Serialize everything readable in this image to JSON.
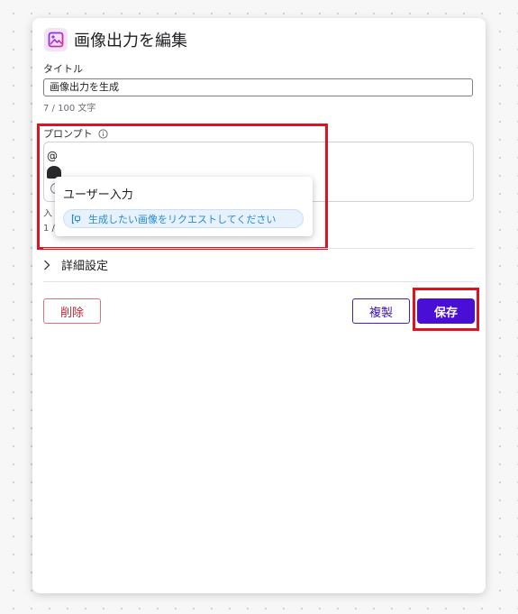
{
  "dialog": {
    "title": "画像出力を編集",
    "icon": "image-icon"
  },
  "title_field": {
    "label": "タイトル",
    "value": "画像出力を生成",
    "counter": "7 / 100 文字"
  },
  "prompt_field": {
    "label": "プロンプト",
    "info_icon": "info-icon",
    "text": "@",
    "peek_label_fragment": "入",
    "peek_counter_fragment": "1 /"
  },
  "mention_dropdown": {
    "title": "ユーザー入力",
    "option_icon": "variable-icon",
    "option_label": "生成したい画像をリクエストしてください"
  },
  "details": {
    "label": "詳細設定",
    "icon": "chevron-right-icon"
  },
  "actions": {
    "delete_label": "削除",
    "copy_label": "複製",
    "save_label": "保存"
  },
  "colors": {
    "primary": "#4a0fd6",
    "danger": "#c0283a",
    "highlight": "#e0121e",
    "chip_text": "#2589d8",
    "chip_bg": "#e7f2fc"
  }
}
